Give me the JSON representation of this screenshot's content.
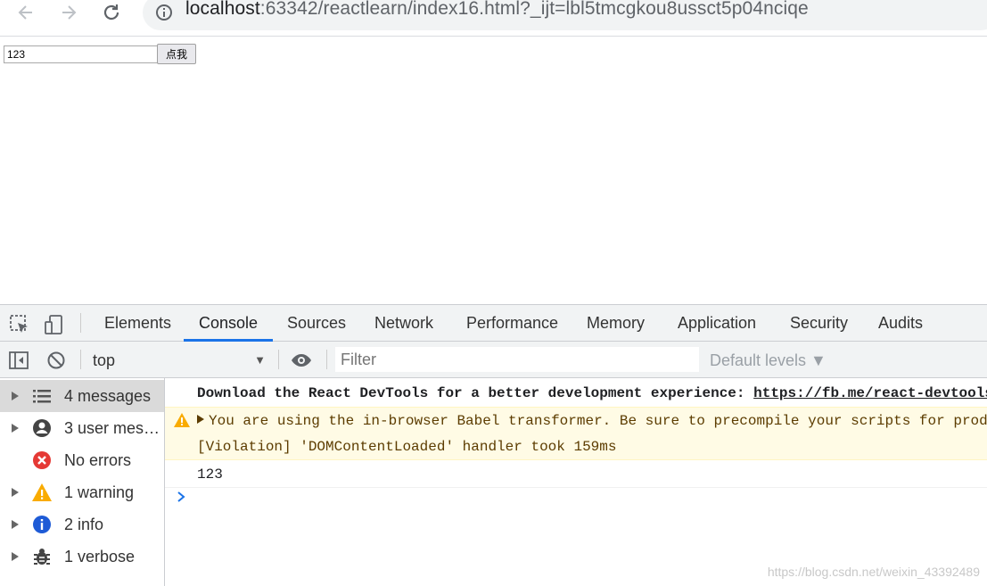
{
  "browser": {
    "url_host": "localhost",
    "url_rest": ":63342/reactlearn/index16.html?_ijt=lbl5tmcgkou8ussct5p04nciqe"
  },
  "page": {
    "input_value": "123",
    "button_label": "点我"
  },
  "devtools": {
    "tabs": [
      {
        "label": "Elements"
      },
      {
        "label": "Console"
      },
      {
        "label": "Sources"
      },
      {
        "label": "Network"
      },
      {
        "label": "Performance"
      },
      {
        "label": "Memory"
      },
      {
        "label": "Application"
      },
      {
        "label": "Security"
      },
      {
        "label": "Audits"
      }
    ],
    "active_tab": "Console",
    "context": "top",
    "filter_placeholder": "Filter",
    "levels_label": "Default levels ▼",
    "sidebar": [
      {
        "label": "4 messages",
        "icon": "list-icon",
        "selected": true
      },
      {
        "label": "3 user mess…",
        "icon": "user-icon"
      },
      {
        "label": "No errors",
        "icon": "error-icon"
      },
      {
        "label": "1 warning",
        "icon": "warning-icon"
      },
      {
        "label": "2 info",
        "icon": "info-icon"
      },
      {
        "label": "1 verbose",
        "icon": "bug-icon"
      }
    ],
    "messages": [
      {
        "text": "Download the React DevTools for a better development experience: ",
        "link": "https://fb.me/react-devtools"
      },
      {
        "text": "You are using the in-browser Babel transformer. Be sure to precompile your scripts for production"
      },
      {
        "text": "[Violation] 'DOMContentLoaded' handler took 159ms"
      },
      {
        "text": "123"
      }
    ]
  },
  "colors": {
    "accent": "#1a73e8",
    "warning_bg": "#fffbe5",
    "warning_text": "#5c3c00"
  },
  "watermark": "https://blog.csdn.net/weixin_43392489"
}
